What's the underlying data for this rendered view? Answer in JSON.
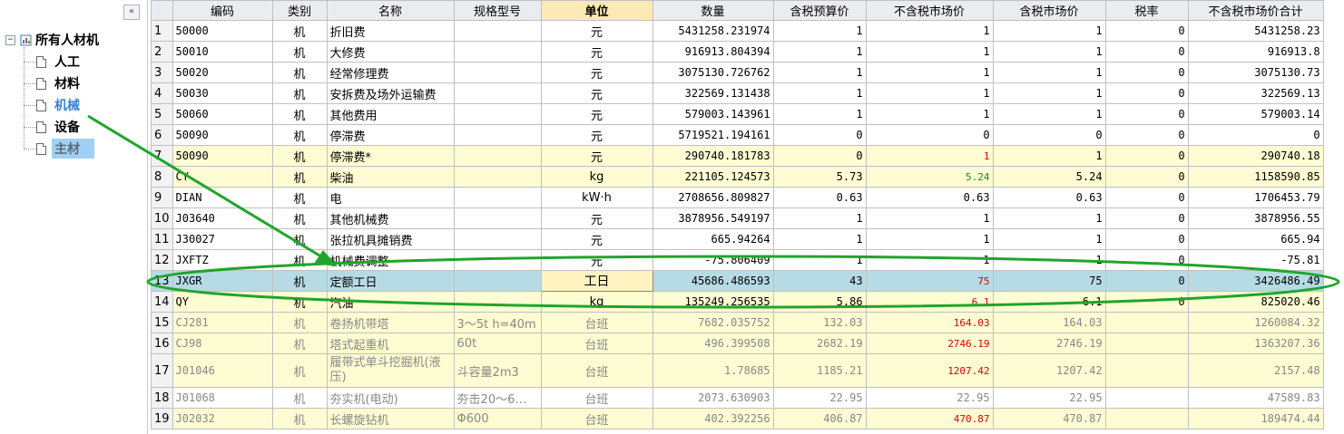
{
  "sidebar": {
    "collapse_label": "«",
    "root_toggle": "−",
    "root_label": "所有人材机",
    "items": [
      {
        "label": "人工"
      },
      {
        "label": "材料"
      },
      {
        "label": "机械"
      },
      {
        "label": "设备"
      },
      {
        "label": "主材"
      }
    ]
  },
  "grid": {
    "columns": [
      "编码",
      "类别",
      "名称",
      "规格型号",
      "单位",
      "数量",
      "含税预算价",
      "不含税市场价",
      "含税市场价",
      "税率",
      "不含税市场价合计"
    ],
    "rows": [
      {
        "n": "1",
        "code": "50000",
        "cat": "机",
        "name": "折旧费",
        "spec": "",
        "unit": "元",
        "qty": "5431258.231974",
        "tax_budget": "1",
        "mkt_notax": "1",
        "mkt_tax": "1",
        "rate": "0",
        "total": "5431258.23"
      },
      {
        "n": "2",
        "code": "50010",
        "cat": "机",
        "name": "大修费",
        "spec": "",
        "unit": "元",
        "qty": "916913.804394",
        "tax_budget": "1",
        "mkt_notax": "1",
        "mkt_tax": "1",
        "rate": "0",
        "total": "916913.8"
      },
      {
        "n": "3",
        "code": "50020",
        "cat": "机",
        "name": "经常修理费",
        "spec": "",
        "unit": "元",
        "qty": "3075130.726762",
        "tax_budget": "1",
        "mkt_notax": "1",
        "mkt_tax": "1",
        "rate": "0",
        "total": "3075130.73"
      },
      {
        "n": "4",
        "code": "50030",
        "cat": "机",
        "name": "安拆费及场外运输费",
        "spec": "",
        "unit": "元",
        "qty": "322569.131438",
        "tax_budget": "1",
        "mkt_notax": "1",
        "mkt_tax": "1",
        "rate": "0",
        "total": "322569.13"
      },
      {
        "n": "5",
        "code": "50060",
        "cat": "机",
        "name": "其他费用",
        "spec": "",
        "unit": "元",
        "qty": "579003.143961",
        "tax_budget": "1",
        "mkt_notax": "1",
        "mkt_tax": "1",
        "rate": "0",
        "total": "579003.14"
      },
      {
        "n": "6",
        "code": "50090",
        "cat": "机",
        "name": "停滞费",
        "spec": "",
        "unit": "元",
        "qty": "5719521.194161",
        "tax_budget": "0",
        "mkt_notax": "0",
        "mkt_tax": "0",
        "rate": "0",
        "total": "0"
      },
      {
        "n": "7",
        "code": "50090",
        "cat": "机",
        "name": "停滞费*",
        "spec": "",
        "unit": "元",
        "qty": "290740.181783",
        "tax_budget": "0",
        "mkt_notax": "1",
        "mkt_tax": "1",
        "rate": "0",
        "total": "290740.18"
      },
      {
        "n": "8",
        "code": "CY",
        "cat": "机",
        "name": "柴油",
        "spec": "",
        "unit": "kg",
        "qty": "221105.124573",
        "tax_budget": "5.73",
        "mkt_notax": "5.24",
        "mkt_tax": "5.24",
        "rate": "0",
        "total": "1158590.85"
      },
      {
        "n": "9",
        "code": "DIAN",
        "cat": "机",
        "name": "电",
        "spec": "",
        "unit": "kW·h",
        "qty": "2708656.809827",
        "tax_budget": "0.63",
        "mkt_notax": "0.63",
        "mkt_tax": "0.63",
        "rate": "0",
        "total": "1706453.79"
      },
      {
        "n": "10",
        "code": "J03640",
        "cat": "机",
        "name": "其他机械费",
        "spec": "",
        "unit": "元",
        "qty": "3878956.549197",
        "tax_budget": "1",
        "mkt_notax": "1",
        "mkt_tax": "1",
        "rate": "0",
        "total": "3878956.55"
      },
      {
        "n": "11",
        "code": "J30027",
        "cat": "机",
        "name": "张拉机具摊销费",
        "spec": "",
        "unit": "元",
        "qty": "665.94264",
        "tax_budget": "1",
        "mkt_notax": "1",
        "mkt_tax": "1",
        "rate": "0",
        "total": "665.94"
      },
      {
        "n": "12",
        "code": "JXFTZ",
        "cat": "机",
        "name": "机械费调整",
        "spec": "",
        "unit": "元",
        "qty": "-75.806409",
        "tax_budget": "1",
        "mkt_notax": "1",
        "mkt_tax": "1",
        "rate": "0",
        "total": "-75.81"
      },
      {
        "n": "13",
        "code": "JXGR",
        "cat": "机",
        "name": "定额工日",
        "spec": "",
        "unit": "工日",
        "qty": "45686.486593",
        "tax_budget": "43",
        "mkt_notax": "75",
        "mkt_tax": "75",
        "rate": "0",
        "total": "3426486.49"
      },
      {
        "n": "14",
        "code": "QY",
        "cat": "机",
        "name": "汽油",
        "spec": "",
        "unit": "kg",
        "qty": "135249.256535",
        "tax_budget": "5.86",
        "mkt_notax": "6.1",
        "mkt_tax": "6.1",
        "rate": "0",
        "total": "825020.46"
      },
      {
        "n": "15",
        "code": "CJ281",
        "cat": "机",
        "name": "卷扬机带塔",
        "spec": "3～5t h=40m",
        "unit": "台班",
        "qty": "7682.035752",
        "tax_budget": "132.03",
        "mkt_notax": "164.03",
        "mkt_tax": "164.03",
        "rate": "",
        "total": "1260084.32"
      },
      {
        "n": "16",
        "code": "CJ98",
        "cat": "机",
        "name": "塔式起重机",
        "spec": "60t",
        "unit": "台班",
        "qty": "496.399508",
        "tax_budget": "2682.19",
        "mkt_notax": "2746.19",
        "mkt_tax": "2746.19",
        "rate": "",
        "total": "1363207.36"
      },
      {
        "n": "17",
        "code": "J01046",
        "cat": "机",
        "name": "履带式单斗挖掘机(液压)",
        "spec": "斗容量2m3",
        "unit": "台班",
        "qty": "1.78685",
        "tax_budget": "1185.21",
        "mkt_notax": "1207.42",
        "mkt_tax": "1207.42",
        "rate": "",
        "total": "2157.48"
      },
      {
        "n": "18",
        "code": "J01068",
        "cat": "机",
        "name": "夯实机(电动)",
        "spec": "夯击20～6…",
        "unit": "台班",
        "qty": "2073.630903",
        "tax_budget": "22.95",
        "mkt_notax": "22.95",
        "mkt_tax": "22.95",
        "rate": "",
        "total": "47589.83"
      },
      {
        "n": "19",
        "code": "J02032",
        "cat": "机",
        "name": "长螺旋钻机",
        "spec": "Φ600",
        "unit": "台班",
        "qty": "402.392256",
        "tax_budget": "406.87",
        "mkt_notax": "470.87",
        "mkt_tax": "470.87",
        "rate": "",
        "total": "189474.44"
      }
    ]
  },
  "colors": {
    "row_yellow": "#fefcd2",
    "row_selected": "#b6dbe4",
    "header_highlight": "#fde9b6",
    "annotation_green": "#1fa52a",
    "price_red": "#e00000",
    "price_green": "#1b8a1b"
  }
}
